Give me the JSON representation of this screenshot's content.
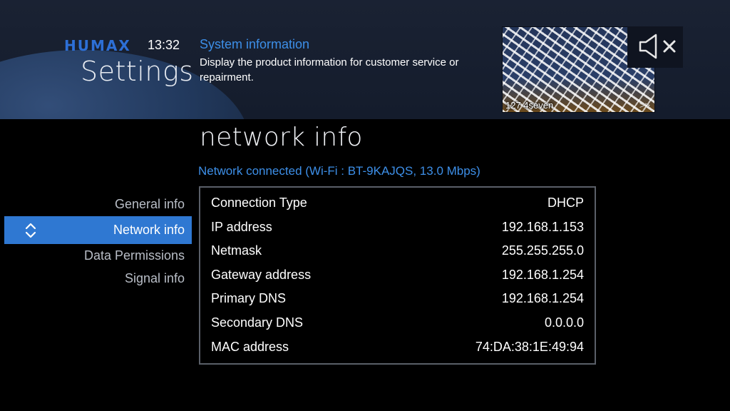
{
  "header": {
    "brand": "HUMAX",
    "time": "13:32",
    "title": "Settings",
    "info_heading": "System information",
    "info_description": "Display the product information for customer service or repairment."
  },
  "preview": {
    "channel_caption": "127 4seven",
    "arrows": ">>"
  },
  "mute_icon": "speaker-muted-icon",
  "page": {
    "heading": "network info",
    "status": "Network connected (Wi-Fi : BT-9KAJQS, 13.0 Mbps)"
  },
  "menu": {
    "items": [
      {
        "label": "General info",
        "active": false
      },
      {
        "label": "Network info",
        "active": true
      },
      {
        "label": "Data Permissions",
        "active": false
      },
      {
        "label": "Signal info",
        "active": false
      }
    ],
    "active_icon": "up-down-chevron-icon"
  },
  "network_info": {
    "rows": [
      {
        "label": "Connection Type",
        "value": "DHCP"
      },
      {
        "label": "IP address",
        "value": "192.168.1.153"
      },
      {
        "label": "Netmask",
        "value": "255.255.255.0"
      },
      {
        "label": "Gateway address",
        "value": "192.168.1.254"
      },
      {
        "label": "Primary DNS",
        "value": "192.168.1.254"
      },
      {
        "label": "Secondary DNS",
        "value": "0.0.0.0"
      },
      {
        "label": "MAC address",
        "value": "74:DA:38:1E:49:94"
      }
    ]
  },
  "colors": {
    "accent_blue": "#2f78d2",
    "link_blue": "#3d8fe8",
    "brand_blue": "#2d6fd6"
  }
}
